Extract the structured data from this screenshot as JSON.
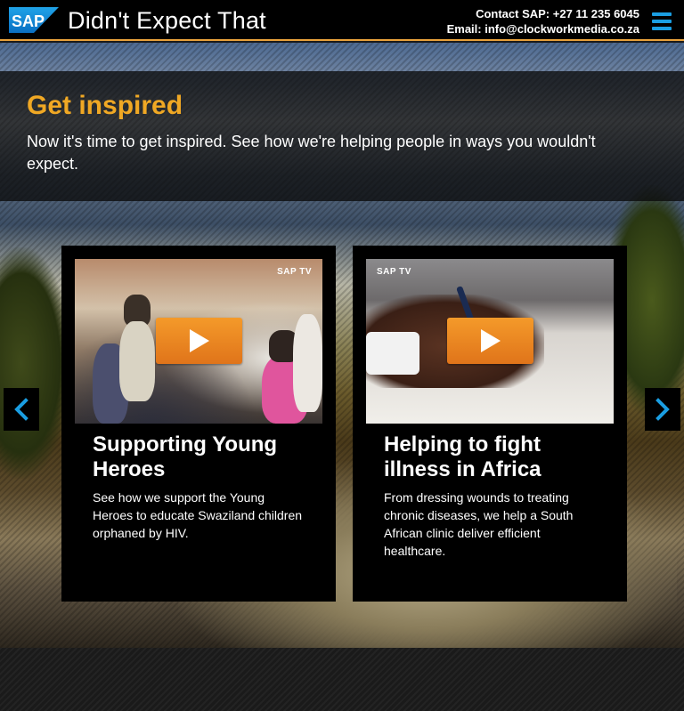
{
  "header": {
    "logo_text": "SAP",
    "title": "Didn't Expect That",
    "contact_line": "Contact SAP: +27 11 235 6045",
    "email_line": "Email: info@clockworkmedia.co.za",
    "menu_icon": "hamburger-icon"
  },
  "intro": {
    "heading": "Get inspired",
    "text": "Now it's time to get inspired. See how we're helping people in ways you wouldn't expect."
  },
  "carousel": {
    "prev_icon": "chevron-left-icon",
    "next_icon": "chevron-right-icon",
    "cards": [
      {
        "badge": "SAP TV",
        "title": "Supporting Young Heroes",
        "description": "See how we support the Young Heroes to educate Swaziland children orphaned by HIV."
      },
      {
        "badge": "SAP TV",
        "title": "Helping to fight illness in Africa",
        "description": "From dressing wounds to treating chronic diseases, we help a South African clinic deliver efficient healthcare."
      }
    ]
  },
  "colors": {
    "accent": "#f0a824",
    "brand_blue": "#1a9ee2",
    "play_button": "#e98420"
  }
}
